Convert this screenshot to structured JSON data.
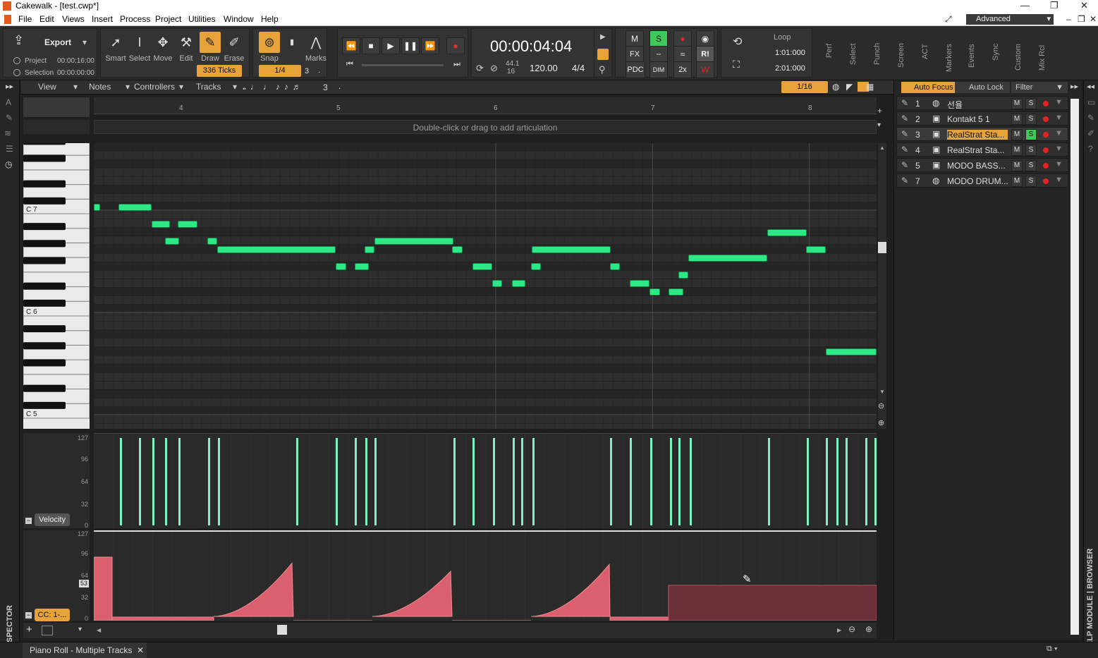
{
  "window": {
    "title": "Cakewalk - [test.cwp*]",
    "controls": [
      "—",
      "❐",
      "✕"
    ]
  },
  "menu": {
    "items": [
      "File",
      "Edit",
      "Views",
      "Insert",
      "Process",
      "Project",
      "Utilities",
      "Window",
      "Help"
    ],
    "workspace": "Advanced"
  },
  "toolbar": {
    "export": "Export",
    "project_label": "Project",
    "project_time": "00:00:16:00",
    "selection_label": "Selection",
    "selection_time": "00:00:00:00",
    "tools": [
      "Smart",
      "Select",
      "Move",
      "Edit",
      "Draw",
      "Erase"
    ],
    "ticks": "336 Ticks",
    "snap": "Snap",
    "snap_value": "1/4",
    "snap_count": "3",
    "marks": "Marks",
    "time": "00:00:04:04",
    "sample_rate": "44.1",
    "bit_depth": "16",
    "tempo": "120.00",
    "meter": "4/4",
    "mix": {
      "m": "M",
      "s": "S",
      "fx": "FX",
      "pdc": "PDC",
      "dim": "DIM",
      "x2": "2x",
      "ri": "R!"
    },
    "loop": "Loop",
    "loop_start": "1:01:000",
    "loop_end": "2:01:000",
    "modules": [
      "Perf",
      "Select",
      "Punch",
      "Screen",
      "ACT",
      "Markers",
      "Events",
      "Sync",
      "Custom",
      "Mix Rcl"
    ]
  },
  "pianoroll": {
    "view": "View",
    "notes": "Notes",
    "controllers": "Controllers",
    "tracks": "Tracks",
    "triplet": "3",
    "dot": ".",
    "snap_res": "1/16",
    "ruler_marks": [
      "4",
      "5",
      "6",
      "7",
      "8"
    ],
    "articulation_hint": "Double-click or drag to add articulation",
    "key_labels": [
      "C 7",
      "C 6",
      "C 5"
    ],
    "velocity_label": "Velocity",
    "cc_label": "CC: 1-...",
    "vel_axis": [
      "127",
      "96",
      "64",
      "32",
      "0"
    ],
    "cc_axis": [
      "127",
      "96",
      "64",
      "32",
      "0"
    ],
    "cc_value": "53",
    "tab": "Piano Roll - Multiple Tracks"
  },
  "trackpane": {
    "auto_focus": "Auto Focus",
    "auto_lock": "Auto Lock",
    "filter": "Filter",
    "tracks": [
      {
        "num": "1",
        "name": "선율",
        "solo": false,
        "selected": false
      },
      {
        "num": "2",
        "name": "Kontakt 5 1",
        "solo": false,
        "selected": false
      },
      {
        "num": "3",
        "name": "RealStrat Sta...",
        "solo": true,
        "selected": true
      },
      {
        "num": "4",
        "name": "RealStrat Sta...",
        "solo": false,
        "selected": false
      },
      {
        "num": "5",
        "name": "MODO BASS...",
        "solo": false,
        "selected": false
      },
      {
        "num": "7",
        "name": "MODO DRUM...",
        "solo": false,
        "selected": false
      }
    ]
  },
  "side": {
    "inspector": "INSPECTOR",
    "right": "HELP MODULE | BROWSER"
  },
  "colors": {
    "note": "#2ee886",
    "accent": "#e8a23a",
    "cc": "#d9606c",
    "solo": "#3ec95a"
  }
}
